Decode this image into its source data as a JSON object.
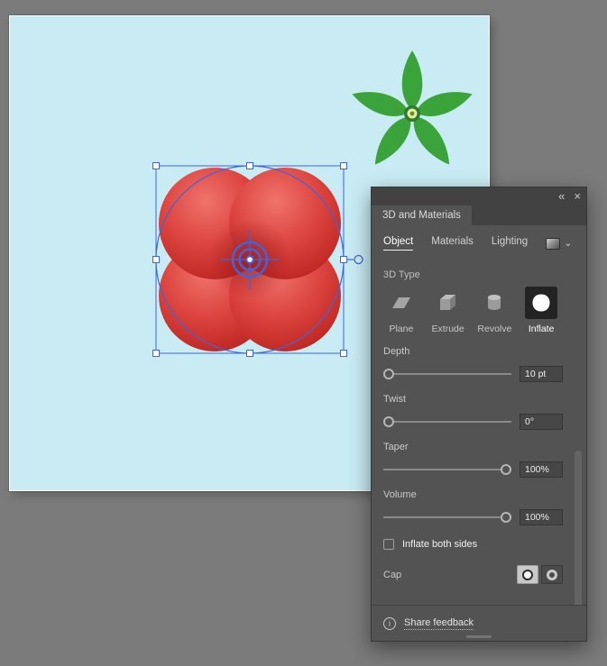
{
  "icons": {
    "collapse": "«",
    "close": "×",
    "chevron_down": "⌄",
    "scroll_down": "⌄",
    "info": "i"
  },
  "panel": {
    "title": "3D and Materials",
    "mode_tabs": [
      {
        "label": "Object",
        "active": true
      },
      {
        "label": "Materials",
        "active": false
      },
      {
        "label": "Lighting",
        "active": false
      }
    ],
    "type_section": {
      "label": "3D Type",
      "options": [
        {
          "label": "Plane",
          "selected": false
        },
        {
          "label": "Extrude",
          "selected": false
        },
        {
          "label": "Revolve",
          "selected": false
        },
        {
          "label": "Inflate",
          "selected": true
        }
      ]
    },
    "sliders": [
      {
        "label": "Depth",
        "value": "10 pt",
        "knob": "left"
      },
      {
        "label": "Twist",
        "value": "0°",
        "knob": "left"
      },
      {
        "label": "Taper",
        "value": "100%",
        "knob": "right"
      },
      {
        "label": "Volume",
        "value": "100%",
        "knob": "right"
      }
    ],
    "inflate_both_sides": {
      "label": "Inflate both sides",
      "checked": false
    },
    "cap": {
      "label": "Cap",
      "selected_option": "solid"
    },
    "footer": {
      "link": "Share feedback"
    }
  },
  "canvas": {
    "artboard_color": "#c9ecf4",
    "selection_color": "#3b66e0",
    "tomato_color": "#d63a35",
    "flower_color": "#3aa33a",
    "selected_object": "inflated-circle"
  }
}
